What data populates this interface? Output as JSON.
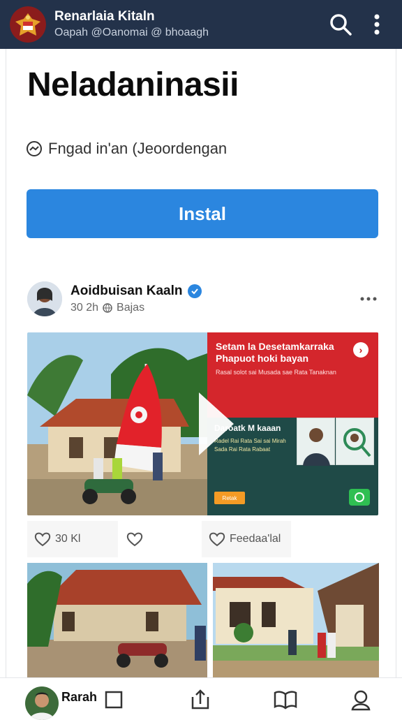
{
  "appbar": {
    "title": "Renarlaia Kitaln",
    "subtitle": "Oapah @Oanomai @ bhoaagh",
    "logo_icon": "garuda-emblem-icon",
    "search_icon": "search-icon",
    "menu_icon": "more-vertical-icon",
    "bg_color": "#23324a"
  },
  "page": {
    "title": "Neladaninasii",
    "developer": "Fngad in'an (Jeoordengan",
    "install_label": "Instal",
    "accent_color": "#2b86df"
  },
  "post": {
    "author": "Aoidbuisan Kaaln",
    "time": "30 2h",
    "audience": "Bajas",
    "verified_icon": "verified-check-icon",
    "more_icon": "more-horizontal-icon",
    "promo": {
      "headline": "Setam la Desetamkarraka Phapuot hoki bayan",
      "subline": "Rasal solot sai Musada sae Rata Tanaknan",
      "mid_title": "Daroatk M kaaan",
      "small_text": "Radel Rai Rata Sai sai Mirah Sada Rai Rata Rabaat",
      "cta": "Retak",
      "close_label": "›"
    },
    "reactions": [
      {
        "icon": "heart-outline-icon",
        "label": "30 Kl"
      },
      {
        "icon": "heart-outline-icon",
        "label": ""
      },
      {
        "icon": "heart-outline-icon",
        "label": "Feedaa'lal"
      }
    ]
  },
  "bottom_bar": {
    "label": "Rarah",
    "icons": [
      "square-icon",
      "share-icon",
      "book-open-icon",
      "person-outline-icon"
    ]
  }
}
